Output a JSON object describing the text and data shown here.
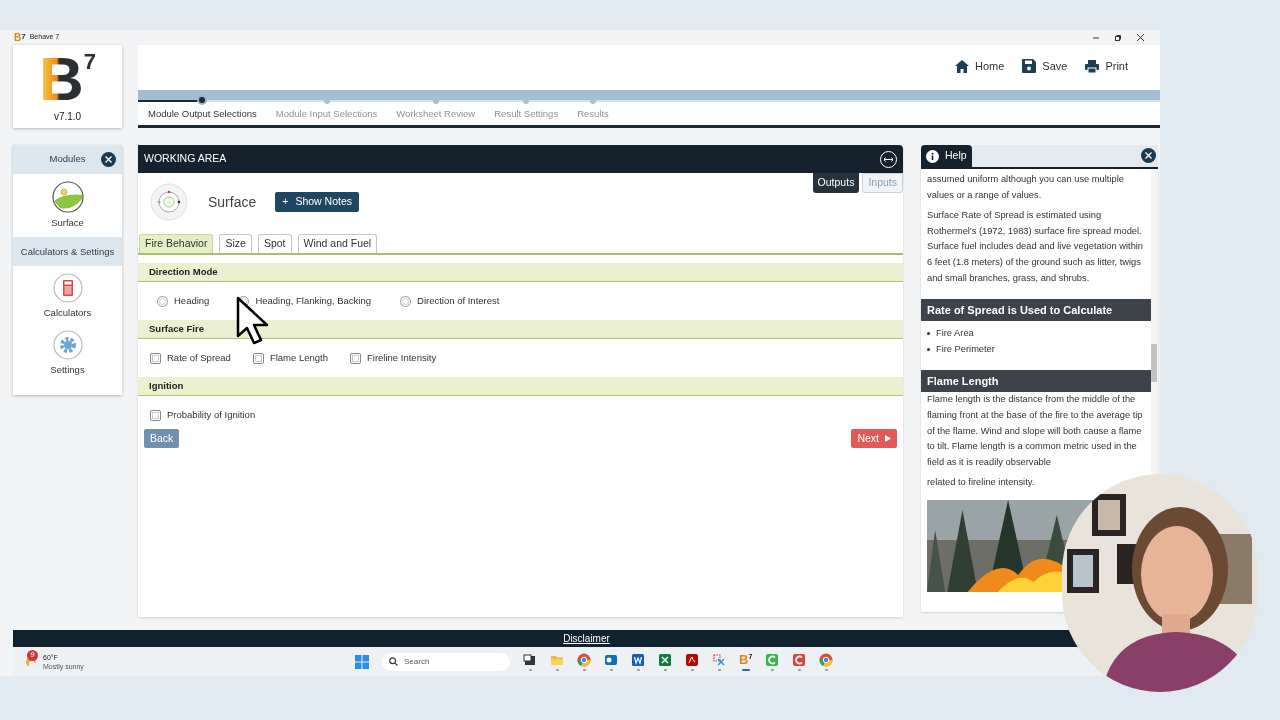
{
  "window": {
    "title": "Behave 7",
    "icon_letter": "B",
    "icon_sup": "7"
  },
  "logo": {
    "letter": "B",
    "sup": "7",
    "version": "v7.1.0"
  },
  "toolbar": [
    {
      "label": "Home",
      "kind": "home"
    },
    {
      "label": "Save",
      "kind": "save"
    },
    {
      "label": "Print",
      "kind": "print"
    }
  ],
  "steps": [
    {
      "label": "Module Output Selections",
      "selected": true
    },
    {
      "label": "Module Input Selections",
      "selected": false
    },
    {
      "label": "Worksheet Review",
      "selected": false
    },
    {
      "label": "Result Settings",
      "selected": false
    },
    {
      "label": "Results",
      "selected": false
    }
  ],
  "sidebar": [
    {
      "title": "Modules",
      "closable": true,
      "items": [
        {
          "label": "Surface",
          "kind": "surface"
        }
      ]
    },
    {
      "title": "Calculators & Settings",
      "closable": false,
      "items": [
        {
          "label": "Calculators",
          "kind": "calculator"
        },
        {
          "label": "Settings",
          "kind": "settings"
        }
      ]
    }
  ],
  "working_area": {
    "title": "WORKING AREA",
    "view_toggle": [
      {
        "label": "Outputs",
        "selected": true
      },
      {
        "label": "Inputs",
        "selected": false
      }
    ],
    "module": "Surface",
    "notes_button": {
      "icon": "+",
      "label": "Show Notes"
    },
    "tabs": [
      {
        "label": "Fire Behavior",
        "selected": true
      },
      {
        "label": "Size",
        "selected": false
      },
      {
        "label": "Spot",
        "selected": false
      },
      {
        "label": "Wind and Fuel",
        "selected": false
      }
    ],
    "groups": [
      {
        "title": "Direction Mode",
        "kind": "radio",
        "options": [
          {
            "label": "Heading",
            "selected": false
          },
          {
            "label": "Heading, Flanking, Backing",
            "selected": false
          },
          {
            "label": "Direction of Interest",
            "selected": false
          }
        ]
      },
      {
        "title": "Surface Fire",
        "kind": "checkbox",
        "options": [
          {
            "label": "Rate of Spread",
            "checked": false
          },
          {
            "label": "Flame Length",
            "checked": false
          },
          {
            "label": "Fireline Intensity",
            "checked": false
          }
        ]
      },
      {
        "title": "Ignition",
        "kind": "checkbox",
        "options": [
          {
            "label": "Probability of Ignition",
            "checked": false
          }
        ]
      }
    ],
    "back": "Back",
    "next": "Next"
  },
  "help": {
    "title": "Help",
    "blocks": [
      {
        "kind": "paragraph",
        "text": "assumed uniform although you can use multiple values or a range of values."
      },
      {
        "kind": "paragraph",
        "text": "Surface Rate of Spread is estimated using Rothermel's (1972, 1983) surface fire spread model. Surface fuel includes dead and live vegetation within 6 feet (1.8 meters) of the ground such as litter, twigs and small branches, grass, and shrubs."
      },
      {
        "kind": "heading",
        "text": "Rate of Spread is Used to Calculate"
      },
      {
        "kind": "list",
        "items": [
          "Fire Area",
          "Fire Perimeter"
        ]
      },
      {
        "kind": "heading",
        "text": "Flame Length"
      },
      {
        "kind": "paragraph",
        "text": "Flame length is the distance from the middle of the flaming front at the base of the fire to the average tip of the flame. Wind and slope will both cause a flame to tilt. Flame length is a common metric used in the field as it is readily observable"
      },
      {
        "kind": "paragraph",
        "text": "related to fireline intensity."
      },
      {
        "kind": "picture"
      }
    ]
  },
  "footer": {
    "link": "Disclaimer"
  },
  "taskbar": {
    "weather": {
      "badge": "9",
      "temp": "60°F",
      "condition": "Mostly sunny"
    },
    "search_placeholder": "Search",
    "apps": [
      {
        "kind": "task-view",
        "selected": false
      },
      {
        "kind": "folder",
        "selected": false
      },
      {
        "kind": "browser",
        "selected": false
      },
      {
        "kind": "mail",
        "selected": false
      },
      {
        "kind": "word",
        "selected": false
      },
      {
        "kind": "sheet",
        "selected": false
      },
      {
        "kind": "pdf",
        "selected": false
      },
      {
        "kind": "snip",
        "selected": false
      },
      {
        "kind": "behave",
        "selected": true,
        "letter": "B",
        "sup": "7"
      },
      {
        "kind": "green-app",
        "selected": false
      },
      {
        "kind": "red-app",
        "selected": false
      },
      {
        "kind": "browser",
        "selected": false
      }
    ]
  }
}
